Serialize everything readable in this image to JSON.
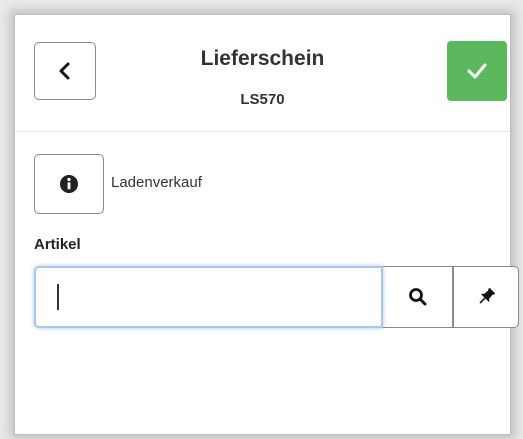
{
  "header": {
    "title": "Lieferschein",
    "number": "LS570",
    "back_icon": "chevron-left-icon",
    "confirm_icon": "checkmark-icon",
    "confirm_color": "#5cb85c"
  },
  "customer": {
    "info_icon": "info-circle-icon",
    "name": "Ladenverkauf"
  },
  "article": {
    "label": "Artikel",
    "value": "",
    "search_icon": "search-icon",
    "pin_icon": "pin-icon"
  }
}
